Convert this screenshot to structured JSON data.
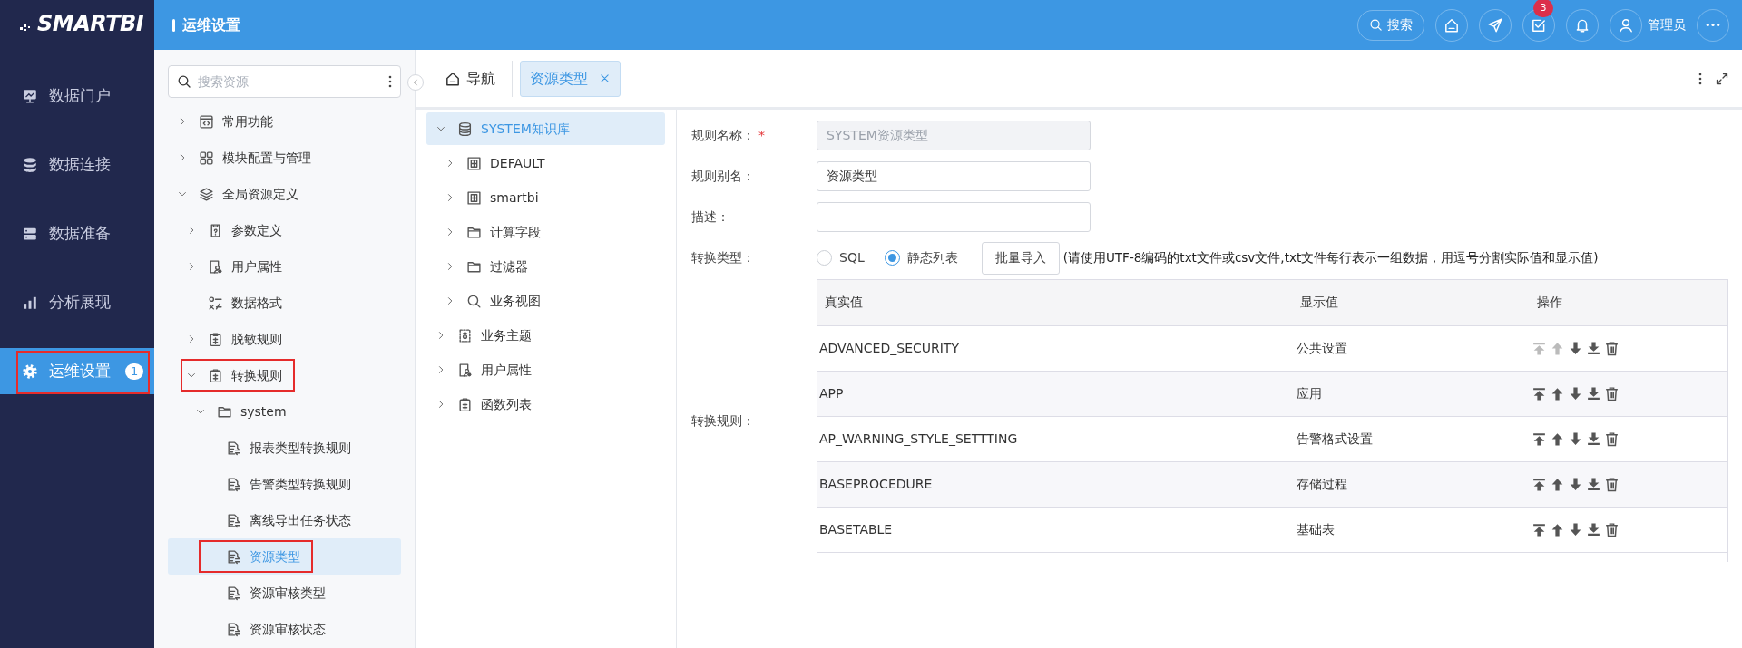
{
  "logo": {
    "text": "SMARTBI"
  },
  "nav": [
    {
      "label": "数据门户",
      "selected": false
    },
    {
      "label": "数据连接",
      "selected": false
    },
    {
      "label": "数据准备",
      "selected": false
    },
    {
      "label": "分析展现",
      "selected": false
    },
    {
      "label": "运维设置",
      "selected": true,
      "highlighted": true,
      "badge": "1"
    }
  ],
  "header": {
    "title": "运维设置",
    "search_label": "搜索",
    "task_badge": "3",
    "user": "管理员"
  },
  "resource_panel": {
    "search_placeholder": "搜索资源",
    "tree": [
      {
        "label": "常用功能",
        "expanded": false,
        "selected": false
      },
      {
        "label": "模块配置与管理",
        "expanded": false,
        "selected": false
      },
      {
        "label": "全局资源定义",
        "expanded": true,
        "selected": false,
        "children": [
          {
            "label": "参数定义",
            "expanded": false,
            "selected": false
          },
          {
            "label": "用户属性",
            "expanded": false,
            "selected": false
          },
          {
            "label": "数据格式",
            "selected": false
          },
          {
            "label": "脱敏规则",
            "expanded": false,
            "selected": false
          },
          {
            "label": "转换规则",
            "expanded": true,
            "selected": false,
            "highlighted": true,
            "children": [
              {
                "label": "system",
                "expanded": true,
                "selected": false,
                "children": [
                  {
                    "label": "报表类型转换规则",
                    "selected": false
                  },
                  {
                    "label": "告警类型转换规则",
                    "selected": false
                  },
                  {
                    "label": "离线导出任务状态",
                    "selected": false
                  },
                  {
                    "label": "资源类型",
                    "selected": true,
                    "highlighted": true
                  },
                  {
                    "label": "资源审核类型",
                    "selected": false
                  },
                  {
                    "label": "资源审核状态",
                    "selected": false
                  }
                ]
              }
            ]
          }
        ]
      }
    ]
  },
  "tabs": [
    {
      "label": "导航",
      "selected": false,
      "closable": false
    },
    {
      "label": "资源类型",
      "selected": true,
      "closable": true
    }
  ],
  "knowledge_tree": [
    {
      "label": "SYSTEM知识库",
      "expanded": true,
      "selected": true,
      "children": [
        {
          "label": "DEFAULT",
          "expanded": false,
          "selected": false
        },
        {
          "label": "smartbi",
          "expanded": false,
          "selected": false
        },
        {
          "label": "计算字段",
          "expanded": false,
          "selected": false
        },
        {
          "label": "过滤器",
          "expanded": false,
          "selected": false
        },
        {
          "label": "业务视图",
          "expanded": false,
          "selected": false
        }
      ]
    },
    {
      "label": "业务主题",
      "expanded": false,
      "selected": false
    },
    {
      "label": "用户属性",
      "expanded": false,
      "selected": false
    },
    {
      "label": "函数列表",
      "expanded": false,
      "selected": false
    }
  ],
  "form": {
    "fields": [
      {
        "label": "规则名称：",
        "required_mark": "*",
        "value": "SYSTEM资源类型",
        "disabled": true
      },
      {
        "label": "规则别名：",
        "value": "资源类型",
        "disabled": false
      },
      {
        "label": "描述：",
        "disabled": false
      }
    ],
    "conversion_type": {
      "label": "转换类型：",
      "options": [
        {
          "label": "SQL",
          "selected": false
        },
        {
          "label": "静态列表",
          "selected": true
        }
      ],
      "import_button": "批量导入",
      "hint": "(请使用UTF-8编码的txt文件或csv文件,txt文件每行表示一组数据，用逗号分割实际值和显示值)"
    },
    "rules": {
      "label": "转换规则：",
      "columns": [
        "真实值",
        "显示值",
        "操作"
      ],
      "rows": [
        {
          "real": "ADVANCED_SECURITY",
          "display": "公共设置",
          "move_up_disabled": true
        },
        {
          "real": "APP",
          "display": "应用",
          "move_up_disabled": false
        },
        {
          "real": "AP_WARNING_STYLE_SETTTING",
          "display": "告警格式设置",
          "move_up_disabled": false
        },
        {
          "real": "BASEPROCEDURE",
          "display": "存储过程",
          "move_up_disabled": false
        },
        {
          "real": "BASETABLE",
          "display": "基础表",
          "move_up_disabled": false
        }
      ]
    }
  }
}
